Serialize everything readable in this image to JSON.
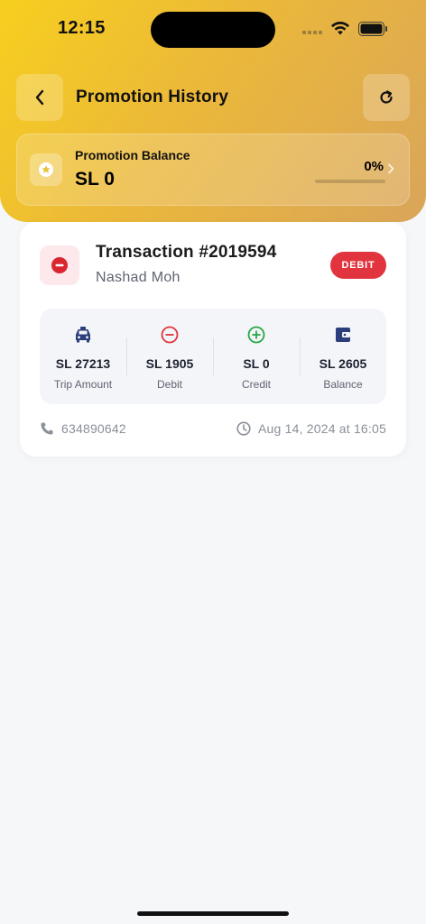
{
  "status_bar": {
    "time": "12:15"
  },
  "header": {
    "title": "Promotion History",
    "balance": {
      "label": "Promotion Balance",
      "value": "SL 0",
      "percent": "0%",
      "progress": 0
    }
  },
  "transaction": {
    "title": "Transaction #2019594",
    "name": "Nashad Moh",
    "badge": "DEBIT",
    "stats": [
      {
        "icon": "taxi-icon",
        "value": "SL 27213",
        "label": "Trip Amount"
      },
      {
        "icon": "minus-circle-icon",
        "value": "SL 1905",
        "label": "Debit"
      },
      {
        "icon": "plus-circle-icon",
        "value": "SL 0",
        "label": "Credit"
      },
      {
        "icon": "wallet-icon",
        "value": "SL 2605",
        "label": "Balance"
      }
    ],
    "phone": "634890642",
    "datetime": "Aug 14, 2024 at 16:05"
  },
  "colors": {
    "accent": "#f7cf1e",
    "debit": "#e1343f",
    "credit": "#28a745",
    "navy": "#2b3d7a"
  }
}
